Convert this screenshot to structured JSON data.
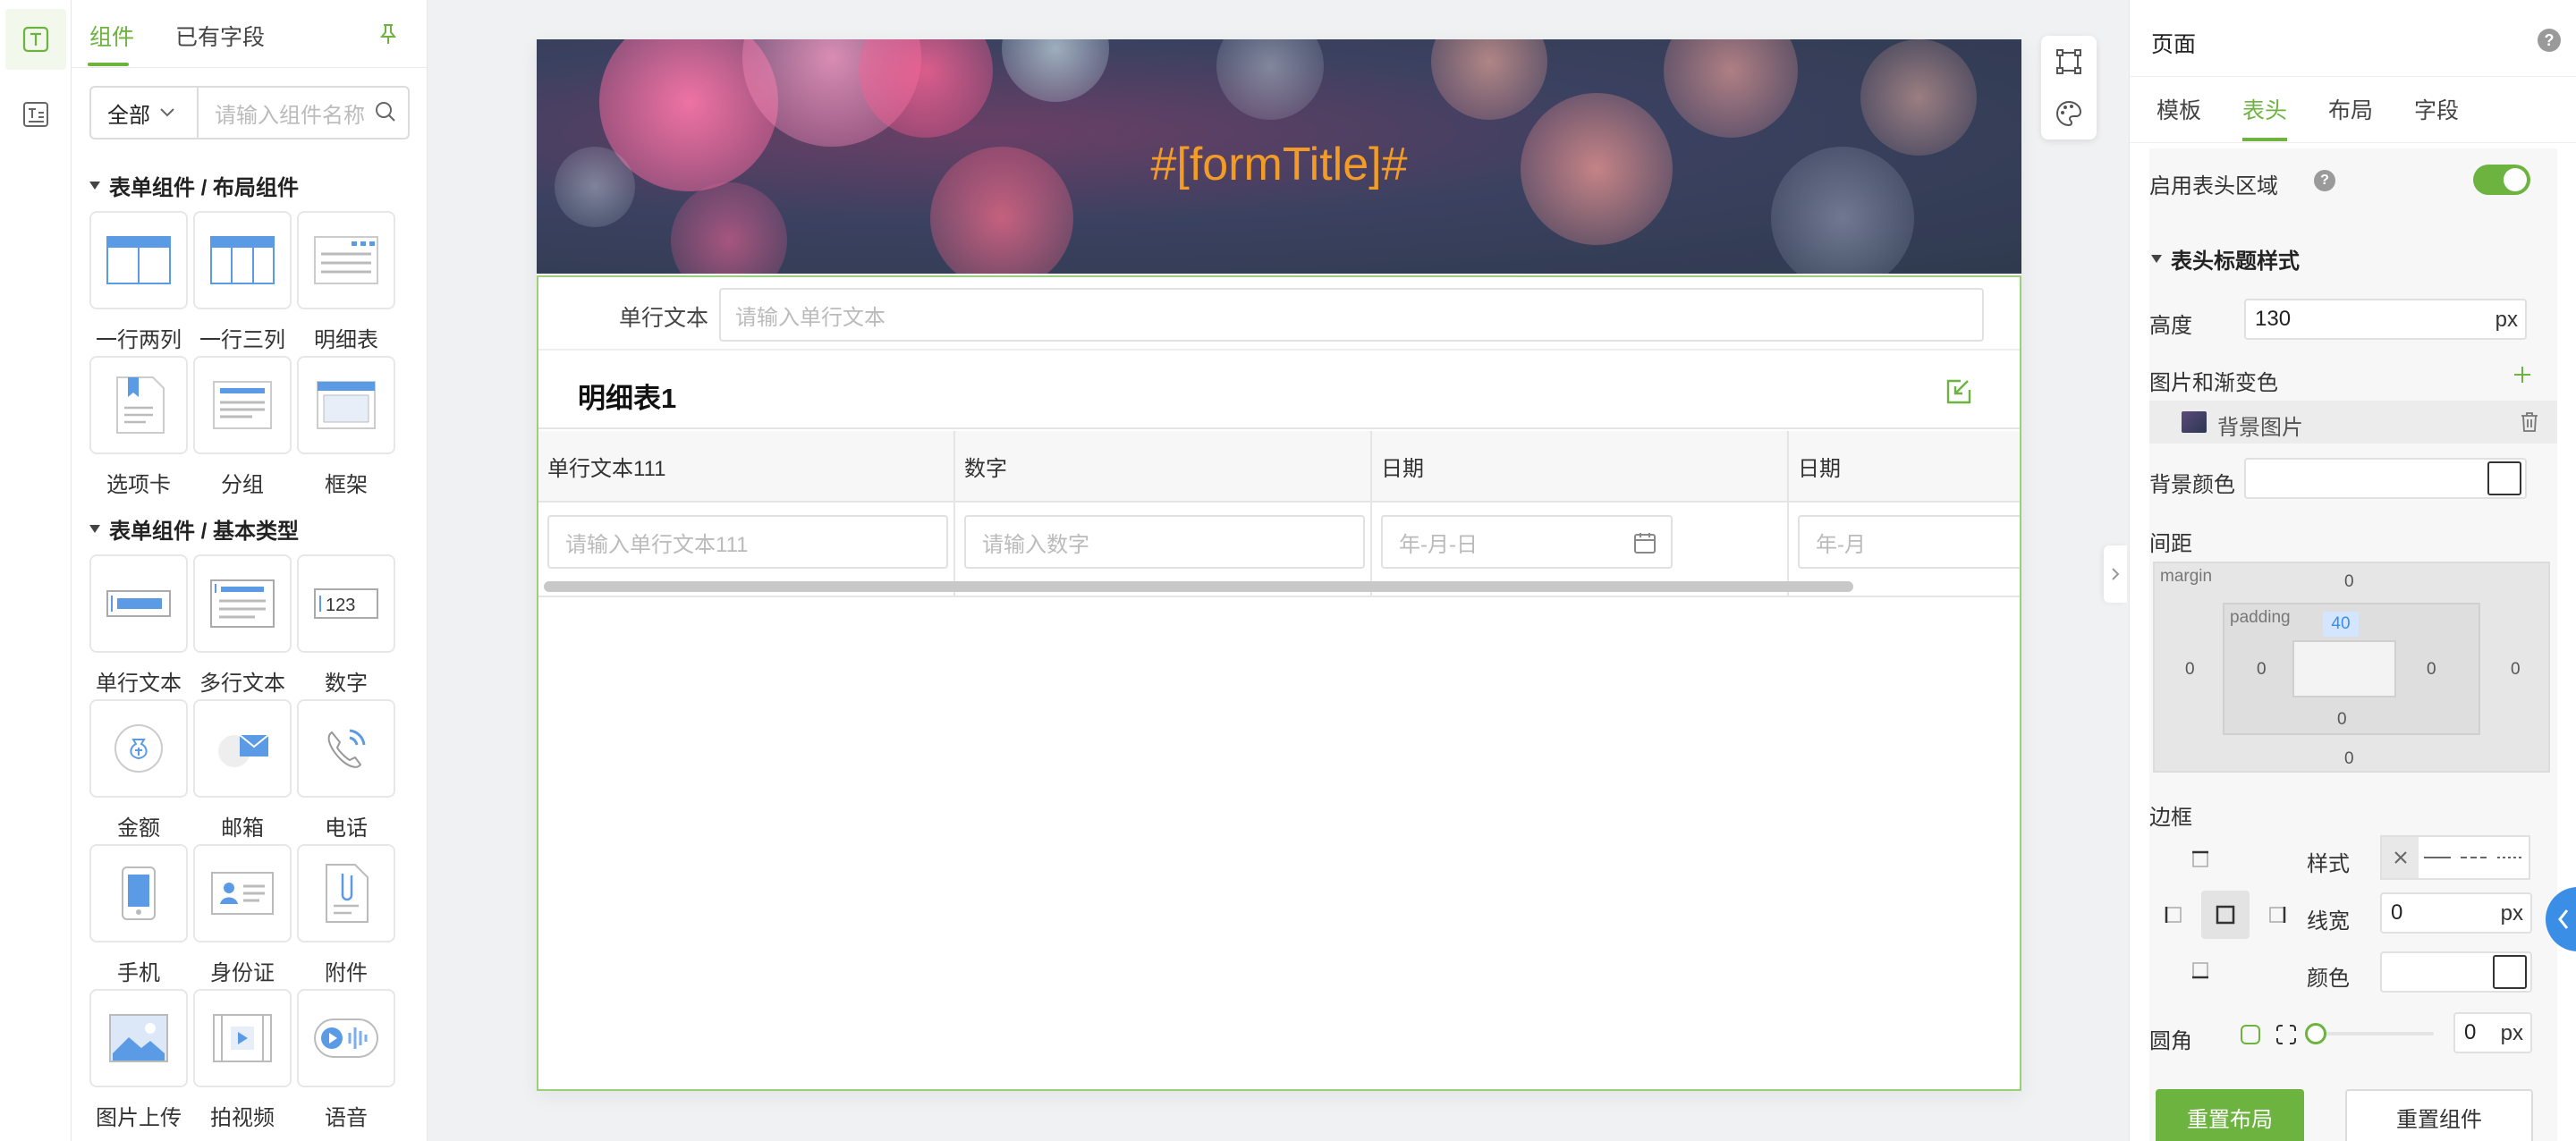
{
  "rail": {
    "icons": [
      "text-component-icon",
      "form-list-icon"
    ]
  },
  "component_panel": {
    "tabs": [
      "组件",
      "已有字段"
    ],
    "filter": {
      "selected": "全部",
      "placeholder": "请输入组件名称"
    },
    "sections": [
      {
        "title": "表单组件 / 布局组件",
        "items": [
          "一行两列",
          "一行三列",
          "明细表",
          "选项卡",
          "分组",
          "框架"
        ]
      },
      {
        "title": "表单组件 / 基本类型",
        "items": [
          "单行文本",
          "多行文本",
          "数字",
          "金额",
          "邮箱",
          "电话",
          "手机",
          "身份证",
          "附件",
          "图片上传",
          "拍视频",
          "语音"
        ]
      }
    ]
  },
  "canvas": {
    "form_title": "#[formTitle]#",
    "single_text": {
      "label": "单行文本",
      "placeholder": "请输入单行文本"
    },
    "detail_table": {
      "title": "明细表1",
      "columns": [
        {
          "header": "单行文本111",
          "placeholder": "请输入单行文本111"
        },
        {
          "header": "数字",
          "placeholder": "请输入数字"
        },
        {
          "header": "日期",
          "placeholder": "年-月-日"
        },
        {
          "header": "日期",
          "placeholder": "年-月"
        }
      ]
    }
  },
  "props": {
    "title": "页面",
    "help": "?",
    "tabs": [
      "模板",
      "表头",
      "布局",
      "字段"
    ],
    "active_tab": "表头",
    "enable_header_label": "启用表头区域",
    "enable_header_on": true,
    "title_style_label": "表头标题样式",
    "height_label": "高度",
    "height_value": "130",
    "unit_px": "px",
    "image_gradient_label": "图片和渐变色",
    "bg_image_label": "背景图片",
    "bg_color_label": "背景颜色",
    "spacing_label": "间距",
    "box_model": {
      "margin_label": "margin",
      "padding_label": "padding",
      "margin_top": "0",
      "margin_right": "0",
      "margin_bottom": "0",
      "margin_left": "0",
      "padding_top": "40",
      "padding_right": "0",
      "padding_bottom": "0",
      "padding_left": "0"
    },
    "border_label": "边框",
    "style_label": "样式",
    "line_width_label": "线宽",
    "line_width_value": "0",
    "color_label": "颜色",
    "radius_label": "圆角",
    "radius_value": "0",
    "reset_layout": "重置布局",
    "reset_components": "重置组件"
  },
  "colors": {
    "accent": "#6db33f",
    "title_orange": "#f29b27",
    "blue": "#3a8ee6"
  }
}
